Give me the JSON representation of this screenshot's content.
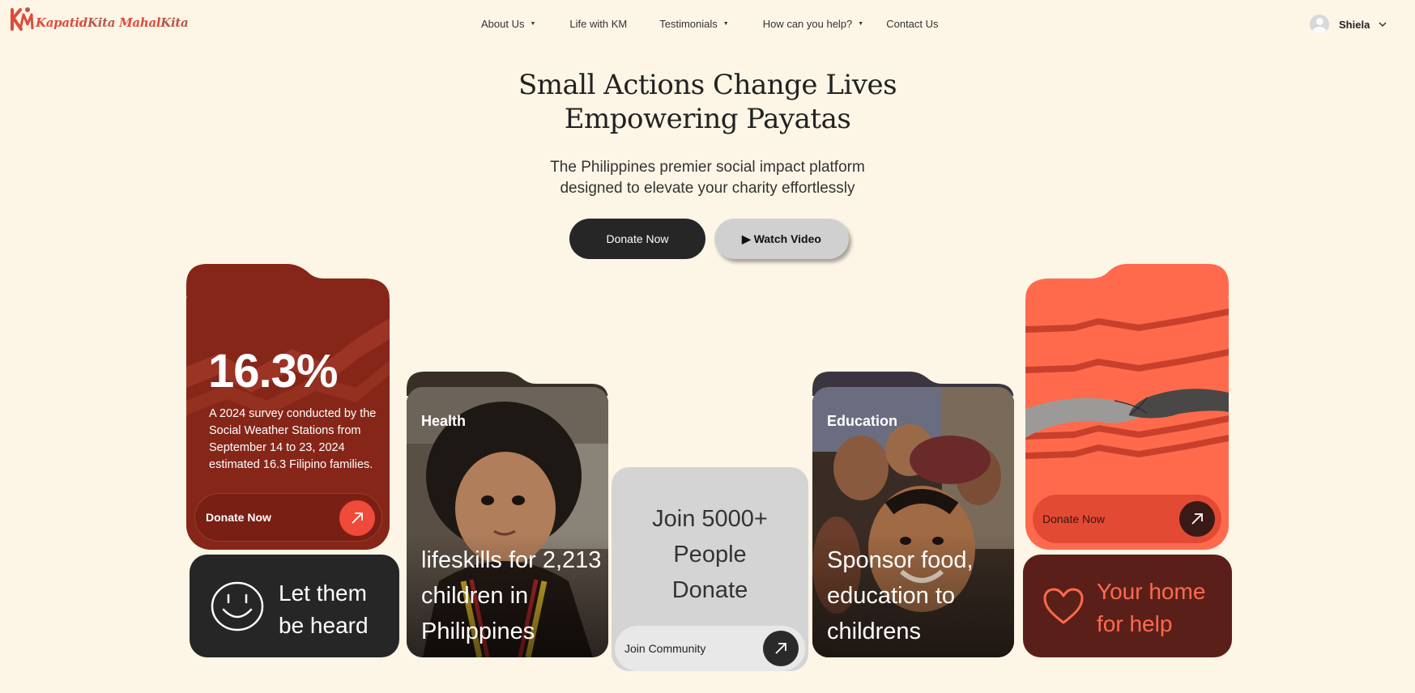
{
  "brand": {
    "part1": "Kapatid",
    "part2": "Kita",
    "part3": "Mahal",
    "part4": "Kita"
  },
  "nav": {
    "items": [
      {
        "label": "About Us",
        "has_dropdown": true
      },
      {
        "label": "Life with KM",
        "has_dropdown": false
      },
      {
        "label": "Testimonials",
        "has_dropdown": true
      },
      {
        "label": "How can you help?",
        "has_dropdown": true
      },
      {
        "label": "Contact Us",
        "has_dropdown": false
      }
    ],
    "user_name": "Shiela"
  },
  "hero": {
    "title_line1": "Small Actions Change Lives",
    "title_line2": "Empowering Payatas",
    "subtitle_line1": "The Philippines premier social impact platform",
    "subtitle_line2": "designed to elevate your charity effortlessly",
    "donate_label": "Donate Now",
    "watch_label": "▶ Watch Video"
  },
  "cards": {
    "stat": {
      "value": "16.3%",
      "description": "A 2024 survey conducted by the Social Weather Stations from September 14 to 23, 2024 estimated 16.3 Filipino families.",
      "button_label": "Donate Now"
    },
    "heard": {
      "line1": "Let them",
      "line2": "be heard"
    },
    "health": {
      "tag": "Health",
      "caption": "lifeskills for 2,213 children in Philippines"
    },
    "community": {
      "line1": "Join 5000+",
      "line2": "People",
      "line3": "Donate",
      "button_label": "Join Community"
    },
    "education": {
      "tag": "Education",
      "caption": "Sponsor food, education to childrens"
    },
    "donate": {
      "button_label": "Donate Now"
    },
    "home": {
      "line1": "Your home",
      "line2": "for help"
    }
  },
  "colors": {
    "background": "#fdf5e6",
    "dark": "#262626",
    "maroon": "#862619",
    "coral": "#ff6a4d",
    "accent_red": "#f04a3a",
    "deep_maroon": "#5b1f1a"
  }
}
